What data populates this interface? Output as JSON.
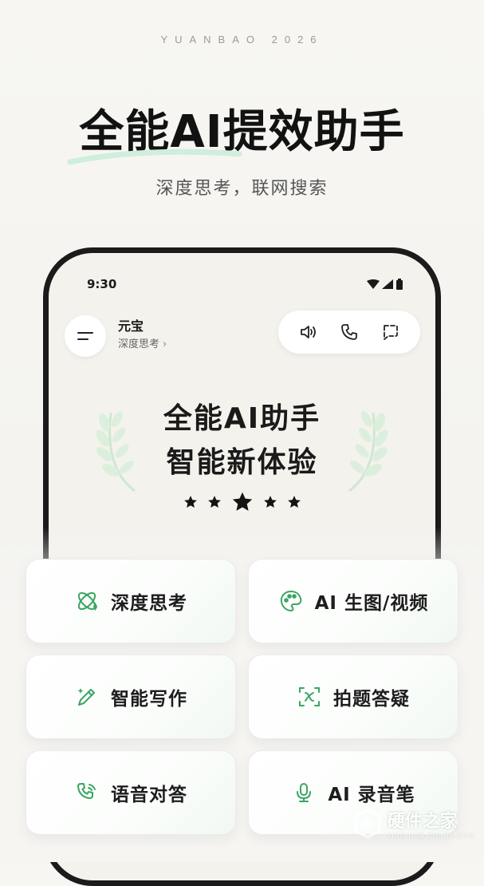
{
  "brand": "YUANBAO 2026",
  "headline": "全能AI提效助手",
  "subheadline": "深度思考，联网搜索",
  "phone": {
    "status_time": "9:30",
    "app_name": "元宝",
    "app_mode": "深度思考",
    "actions": [
      "speaker-icon",
      "phone-call-icon",
      "chat-bubble-icon"
    ],
    "hero_line1": "全能AI助手",
    "hero_line2": "智能新体验",
    "rating_stars": 5
  },
  "features": [
    {
      "label": "深度思考",
      "icon": "atom-sparkle-icon"
    },
    {
      "label": "AI 生图/视频",
      "icon": "palette-icon"
    },
    {
      "label": "智能写作",
      "icon": "pen-sparkle-icon"
    },
    {
      "label": "拍题答疑",
      "icon": "scan-formula-icon"
    },
    {
      "label": "语音对答",
      "icon": "phone-wave-icon"
    },
    {
      "label": "AI 录音笔",
      "icon": "recorder-icon"
    }
  ],
  "watermark": {
    "title": "硬件之家",
    "sub": "YING JIAN ZHI JIA.COM"
  },
  "colors": {
    "accent_green": "#3aa661",
    "headline": "#121212",
    "subtle_text": "#555555"
  }
}
